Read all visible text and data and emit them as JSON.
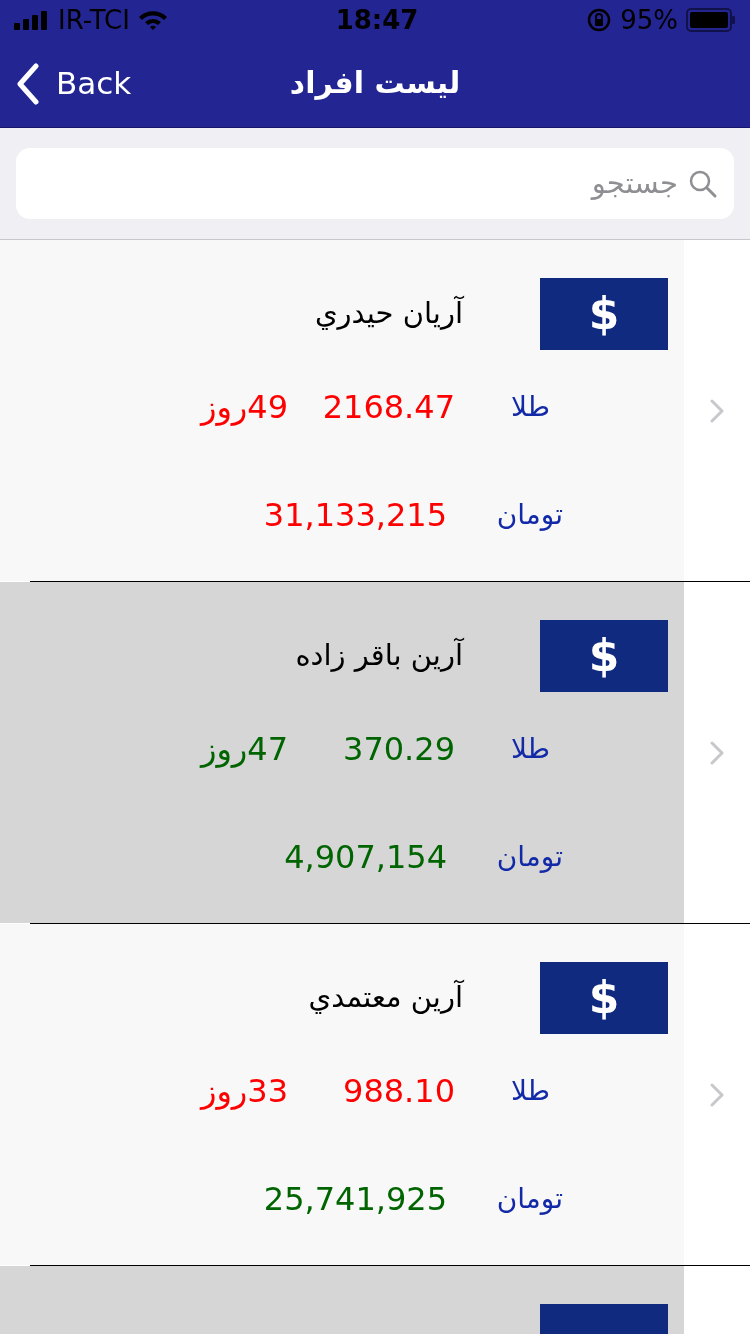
{
  "status_bar": {
    "carrier": "IR-TCI",
    "time": "18:47",
    "battery": "95%"
  },
  "nav": {
    "back": "Back",
    "title": "ليست افراد"
  },
  "search": {
    "placeholder": "جستجو"
  },
  "rows": [
    {
      "highlighted": false,
      "badge": "$",
      "name": "آريان حيدري",
      "gold_label": "طلا",
      "gold": {
        "value": "2168.47",
        "days": "49روز",
        "color": "#ff0000"
      },
      "toman_label": "تومان",
      "toman": {
        "value": "31,133,215",
        "color": "#ff0000"
      }
    },
    {
      "highlighted": true,
      "badge": "$",
      "name": "آرين باقر زاده",
      "gold_label": "طلا",
      "gold": {
        "value": "370.29",
        "days": "47روز",
        "color": "#006400"
      },
      "toman_label": "تومان",
      "toman": {
        "value": "4,907,154",
        "color": "#006400"
      }
    },
    {
      "highlighted": false,
      "badge": "$",
      "name": "آرين معتمدي",
      "gold_label": "طلا",
      "gold": {
        "value": "988.10",
        "days": "33روز",
        "color": "#ff0000"
      },
      "toman_label": "تومان",
      "toman": {
        "value": "25,741,925",
        "color": "#006400"
      }
    },
    {
      "highlighted": true
    }
  ]
}
